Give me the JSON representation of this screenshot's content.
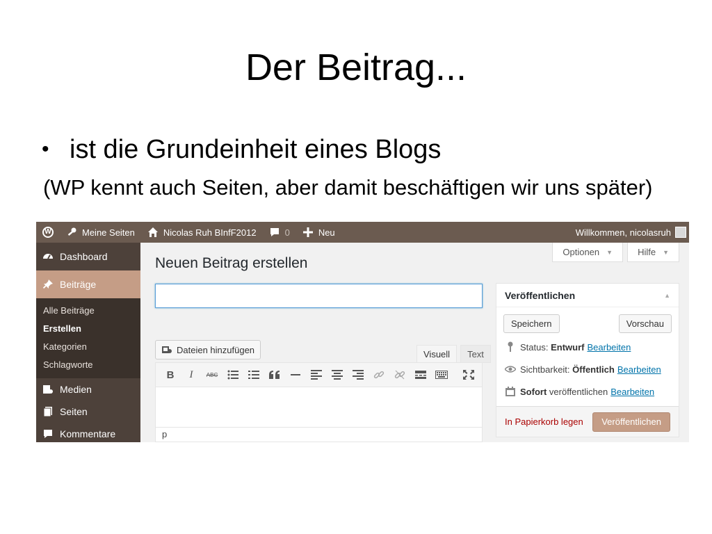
{
  "slide": {
    "title": "Der Beitrag...",
    "bullet_symbol": "•",
    "bullet": "ist die Grundeinheit eines Blogs",
    "note": "(WP kennt auch Seiten, aber damit beschäftigen wir uns später)"
  },
  "adminbar": {
    "my_sites": "Meine Seiten",
    "site_name": "Nicolas Ruh BInfF2012",
    "comments_count": "0",
    "new": "Neu",
    "welcome": "Willkommen, nicolasruh"
  },
  "sidebar": {
    "dashboard": "Dashboard",
    "posts": "Beiträge",
    "submenu": [
      "Alle Beiträge",
      "Erstellen",
      "Kategorien",
      "Schlagworte"
    ],
    "media": "Medien",
    "pages": "Seiten",
    "comments": "Kommentare"
  },
  "screen_options": {
    "options": "Optionen",
    "help": "Hilfe"
  },
  "editor": {
    "heading": "Neuen Beitrag erstellen",
    "title_value": "",
    "add_media": "Dateien hinzufügen",
    "tab_visual": "Visuell",
    "tab_text": "Text",
    "toolbar_bold": "B",
    "toolbar_italic": "I",
    "toolbar_strike": "ABC",
    "path": "p"
  },
  "publish": {
    "title": "Veröffentlichen",
    "save": "Speichern",
    "preview": "Vorschau",
    "status_label": "Status:",
    "status_value": "Entwurf",
    "visibility_label": "Sichtbarkeit:",
    "visibility_value": "Öffentlich",
    "schedule_value": "Sofort",
    "schedule_label": "veröffentlichen",
    "edit": "Bearbeiten",
    "trash": "In Papierkorb legen",
    "publish_button": "Veröffentlichen"
  },
  "colors": {
    "adminbar": "#6b5b50",
    "sidebar": "#4d413a",
    "accent": "#c59d86",
    "link": "#0073aa",
    "danger": "#a00000"
  }
}
